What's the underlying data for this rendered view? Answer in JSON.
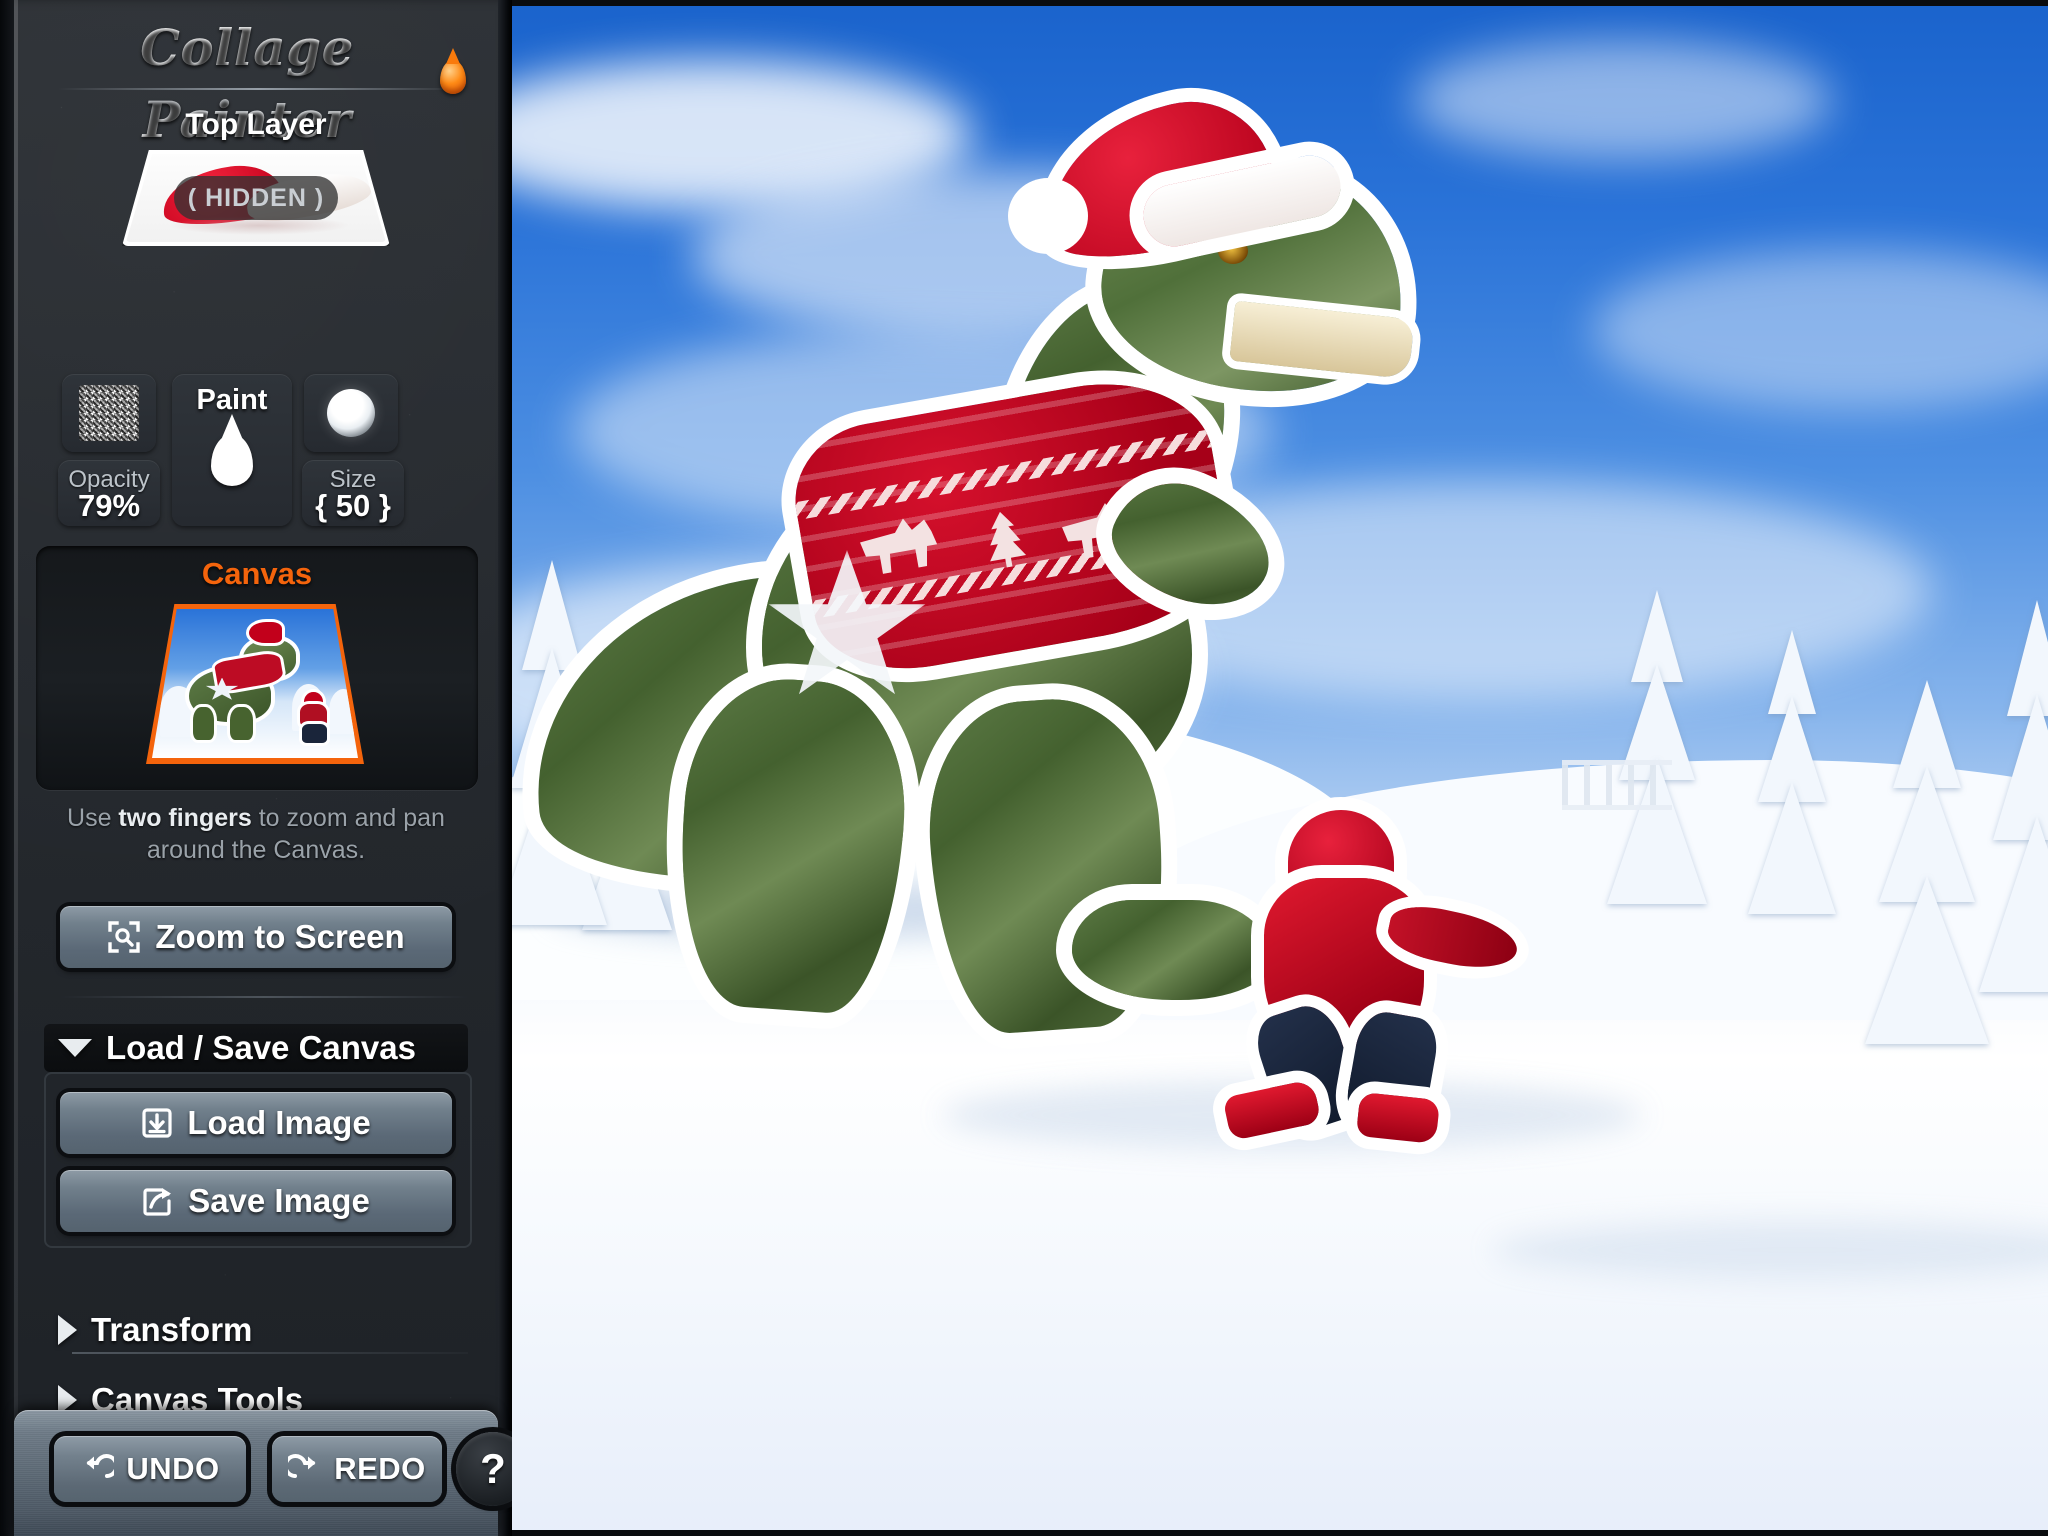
{
  "app": {
    "title": "Collage Painter",
    "logo_accent_color": "#f4640c"
  },
  "sidebar": {
    "top_layer": {
      "label": "Top Layer",
      "thumbnail_name": "santa-hat-layer",
      "state_badge": "( HIDDEN )"
    },
    "tools": {
      "texture_swatch_name": "grain-texture-swatch",
      "opacity_label": "Opacity",
      "opacity_value": "79%",
      "paint_label": "Paint",
      "paint_icon": "paint-drop-icon",
      "brush_preview_name": "soft-round-brush-preview",
      "size_label": "Size",
      "size_value": "{ 50 }"
    },
    "canvas_panel": {
      "title": "Canvas",
      "title_color": "#f4640c",
      "thumbnail_name": "canvas-preview-thumbnail"
    },
    "hint": {
      "prefix": "Use ",
      "bold": "two fingers",
      "suffix": " to zoom and pan around the Canvas."
    },
    "zoom_button": {
      "label": "Zoom to Screen",
      "icon": "zoom-to-fit-icon"
    },
    "load_save_section": {
      "header": "Load / Save Canvas",
      "expanded": true,
      "chevron": "chevron-down-icon",
      "load_button": {
        "label": "Load Image",
        "icon": "download-box-icon"
      },
      "save_button": {
        "label": "Save Image",
        "icon": "share-arrow-icon"
      }
    },
    "transform_section": {
      "header": "Transform",
      "expanded": false,
      "chevron": "chevron-right-icon"
    },
    "canvas_tools_section": {
      "header": "Canvas Tools",
      "expanded": false,
      "chevron": "chevron-right-icon"
    },
    "bottom_bar": {
      "undo": {
        "label": "UNDO",
        "icon": "undo-arrow-icon"
      },
      "redo": {
        "label": "REDO",
        "icon": "redo-arrow-icon"
      },
      "help": {
        "label": "?",
        "icon": "question-mark-icon"
      }
    }
  },
  "canvas": {
    "name": "main-canvas",
    "scene_description": "Snowy winter landscape with blue sky, snow-covered evergreen trees, a cut-out T-rex dinosaur wearing a Santa hat and a red Nordic reindeer sweater, a painted white star on its body, and a child in a red hooded coat walking in the snow.",
    "colors": {
      "sky_blue": "#2a73d8",
      "snow_white": "#ffffff",
      "sweater_red": "#c2001b",
      "dino_green": "#55703e",
      "sticker_outline": "#ffffff"
    }
  }
}
